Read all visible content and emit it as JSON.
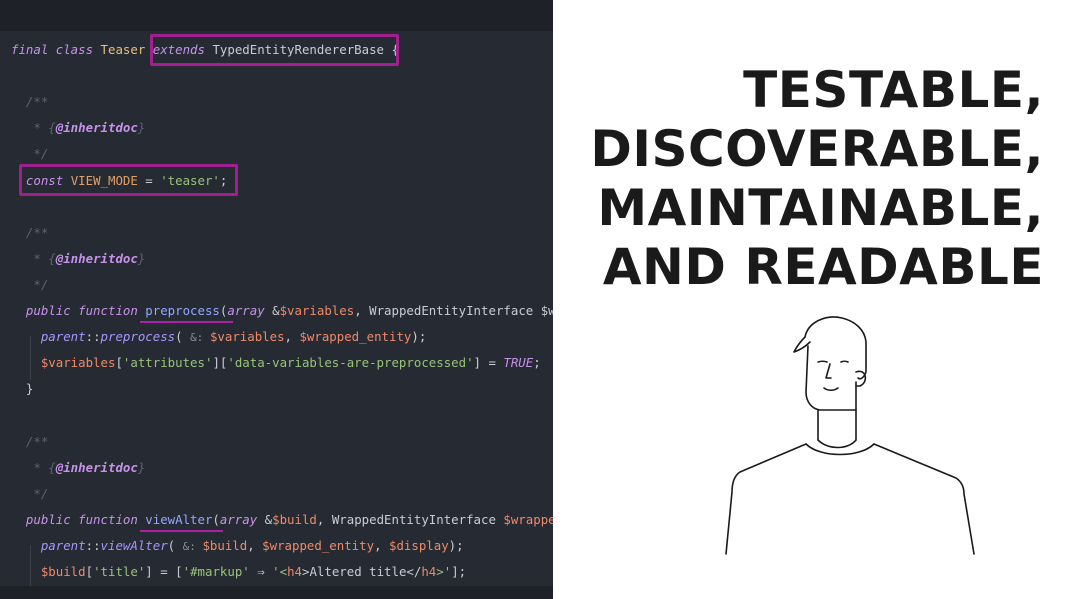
{
  "code": {
    "lines": [
      {
        "tokens": [
          {
            "t": "final ",
            "c": "kw"
          },
          {
            "t": "class ",
            "c": "kw"
          },
          {
            "t": "Teaser ",
            "c": "cls"
          },
          {
            "t": "extends ",
            "c": "kw"
          },
          {
            "t": "TypedEntityRendererBase",
            "c": "type"
          },
          {
            "t": " {",
            "c": "punc"
          }
        ]
      },
      {
        "tokens": []
      },
      {
        "tokens": [
          {
            "t": "  /**",
            "c": "cmt"
          }
        ]
      },
      {
        "tokens": [
          {
            "t": "   * {",
            "c": "cmt"
          },
          {
            "t": "@inheritdoc",
            "c": "tag"
          },
          {
            "t": "}",
            "c": "cmt"
          }
        ]
      },
      {
        "tokens": [
          {
            "t": "   */",
            "c": "cmt"
          }
        ]
      },
      {
        "tokens": [
          {
            "t": "  const ",
            "c": "kw"
          },
          {
            "t": "VIEW_MODE",
            "c": "const"
          },
          {
            "t": " = ",
            "c": "punc"
          },
          {
            "t": "'teaser'",
            "c": "str"
          },
          {
            "t": ";",
            "c": "punc"
          }
        ]
      },
      {
        "tokens": []
      },
      {
        "tokens": [
          {
            "t": "  /**",
            "c": "cmt"
          }
        ]
      },
      {
        "tokens": [
          {
            "t": "   * {",
            "c": "cmt"
          },
          {
            "t": "@inheritdoc",
            "c": "tag"
          },
          {
            "t": "}",
            "c": "cmt"
          }
        ]
      },
      {
        "tokens": [
          {
            "t": "   */",
            "c": "cmt"
          }
        ]
      },
      {
        "tokens": [
          {
            "t": "  public ",
            "c": "kw"
          },
          {
            "t": "function ",
            "c": "kw"
          },
          {
            "t": "preprocess",
            "c": "fn"
          },
          {
            "t": "(",
            "c": "punc"
          },
          {
            "t": "array ",
            "c": "kw"
          },
          {
            "t": "&",
            "c": "punc"
          },
          {
            "t": "$variables",
            "c": "var"
          },
          {
            "t": ", ",
            "c": "punc"
          },
          {
            "t": "WrappedEntityInterface $wrapped_entity",
            "c": "type"
          }
        ]
      },
      {
        "tokens": [
          {
            "t": "    parent",
            "c": "fncall"
          },
          {
            "t": "::",
            "c": "punc"
          },
          {
            "t": "preprocess",
            "c": "fncall"
          },
          {
            "t": "( ",
            "c": "punc"
          },
          {
            "t": "&: ",
            "c": "hint"
          },
          {
            "t": "$variables",
            "c": "var"
          },
          {
            "t": ", ",
            "c": "punc"
          },
          {
            "t": "$wrapped_entity",
            "c": "var"
          },
          {
            "t": ");",
            "c": "punc"
          }
        ]
      },
      {
        "tokens": [
          {
            "t": "    $variables",
            "c": "var"
          },
          {
            "t": "[",
            "c": "punc"
          },
          {
            "t": "'attributes'",
            "c": "str"
          },
          {
            "t": "][",
            "c": "punc"
          },
          {
            "t": "'data-variables-are-preprocessed'",
            "c": "str"
          },
          {
            "t": "] = ",
            "c": "punc"
          },
          {
            "t": "TRUE",
            "c": "bool"
          },
          {
            "t": ";",
            "c": "punc"
          }
        ]
      },
      {
        "tokens": [
          {
            "t": "  }",
            "c": "punc"
          }
        ]
      },
      {
        "tokens": []
      },
      {
        "tokens": [
          {
            "t": "  /**",
            "c": "cmt"
          }
        ]
      },
      {
        "tokens": [
          {
            "t": "   * {",
            "c": "cmt"
          },
          {
            "t": "@inheritdoc",
            "c": "tag"
          },
          {
            "t": "}",
            "c": "cmt"
          }
        ]
      },
      {
        "tokens": [
          {
            "t": "   */",
            "c": "cmt"
          }
        ]
      },
      {
        "tokens": [
          {
            "t": "  public ",
            "c": "kw"
          },
          {
            "t": "function ",
            "c": "kw"
          },
          {
            "t": "viewAlter",
            "c": "fn"
          },
          {
            "t": "(",
            "c": "punc"
          },
          {
            "t": "array ",
            "c": "kw"
          },
          {
            "t": "&",
            "c": "punc"
          },
          {
            "t": "$build",
            "c": "var"
          },
          {
            "t": ", ",
            "c": "punc"
          },
          {
            "t": "WrappedEntityInterface ",
            "c": "type"
          },
          {
            "t": "$wrapped_entity",
            "c": "var"
          }
        ]
      },
      {
        "tokens": [
          {
            "t": "    parent",
            "c": "fncall"
          },
          {
            "t": "::",
            "c": "punc"
          },
          {
            "t": "viewAlter",
            "c": "fncall"
          },
          {
            "t": "( ",
            "c": "punc"
          },
          {
            "t": "&: ",
            "c": "hint"
          },
          {
            "t": "$build",
            "c": "var"
          },
          {
            "t": ", ",
            "c": "punc"
          },
          {
            "t": "$wrapped_entity",
            "c": "var"
          },
          {
            "t": ", ",
            "c": "punc"
          },
          {
            "t": "$display",
            "c": "var"
          },
          {
            "t": ");",
            "c": "punc"
          }
        ]
      },
      {
        "tokens": [
          {
            "t": "    $build",
            "c": "var"
          },
          {
            "t": "[",
            "c": "punc"
          },
          {
            "t": "'title'",
            "c": "str"
          },
          {
            "t": "] = [",
            "c": "punc"
          },
          {
            "t": "'#markup'",
            "c": "str"
          },
          {
            "t": " ⇒ ",
            "c": "op"
          },
          {
            "t": "'<",
            "c": "str"
          },
          {
            "t": "h4",
            "c": "htmltag"
          },
          {
            "t": ">Altered title</",
            "c": "plain"
          },
          {
            "t": "h4",
            "c": "htmltag"
          },
          {
            "t": ">'",
            "c": "str"
          },
          {
            "t": "];",
            "c": "punc"
          }
        ]
      }
    ]
  },
  "headline": {
    "lines": [
      "TESTABLE,",
      "DISCOVERABLE,",
      "MAINTAINABLE,",
      "AND READABLE"
    ]
  },
  "colors": {
    "editor_bg": "#262a32",
    "highlight": "#a0208f",
    "headline": "#1a1a1a"
  },
  "illustration": "person-line-drawing-icon"
}
